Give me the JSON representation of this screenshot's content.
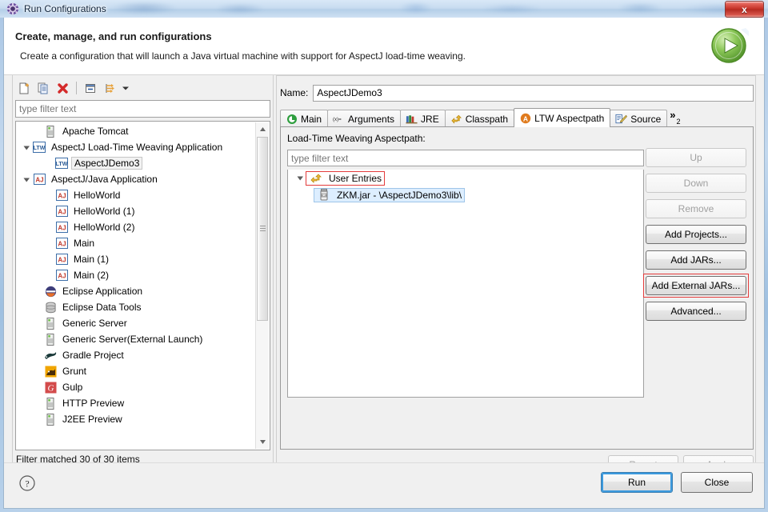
{
  "window": {
    "title": "Run Configurations",
    "title_icon": "gear-icon",
    "close_label": "x"
  },
  "header": {
    "title": "Create, manage, and run configurations",
    "description": "Create a configuration that will launch a Java virtual machine with support for AspectJ load-time weaving.",
    "badge_icon": "run-green-play-icon"
  },
  "left_panel": {
    "toolbar": [
      {
        "name": "new-launch-configuration-icon",
        "icon": "new-document-icon"
      },
      {
        "name": "duplicate-icon",
        "icon": "copy-icon"
      },
      {
        "name": "delete-icon",
        "icon": "red-x-icon"
      },
      {
        "name": "collapse-all-icon",
        "icon": "collapse-all-icon"
      },
      {
        "name": "filter-icon",
        "icon": "filter-arrows-icon"
      },
      {
        "name": "view-menu-icon",
        "icon": "chevron-down-icon"
      }
    ],
    "filter_placeholder": "type filter text",
    "filter_value": "",
    "status": "Filter matched 30 of 30 items",
    "tree": [
      {
        "label": "Apache Tomcat",
        "icon": "server-icon",
        "indent": 2,
        "expander": "none",
        "selected": false
      },
      {
        "label": "AspectJ Load-Time Weaving Application",
        "icon": "ltw-icon",
        "indent": 1,
        "expander": "expanded",
        "selected": false
      },
      {
        "label": "AspectJDemo3",
        "icon": "ltw-icon",
        "indent": 3,
        "expander": "none",
        "selected": true
      },
      {
        "label": "AspectJ/Java Application",
        "icon": "aj-icon",
        "indent": 1,
        "expander": "expanded",
        "selected": false
      },
      {
        "label": "HelloWorld",
        "icon": "aj-icon",
        "indent": 3,
        "expander": "none",
        "selected": false
      },
      {
        "label": "HelloWorld (1)",
        "icon": "aj-icon",
        "indent": 3,
        "expander": "none",
        "selected": false
      },
      {
        "label": "HelloWorld (2)",
        "icon": "aj-icon",
        "indent": 3,
        "expander": "none",
        "selected": false
      },
      {
        "label": "Main",
        "icon": "aj-icon",
        "indent": 3,
        "expander": "none",
        "selected": false
      },
      {
        "label": "Main (1)",
        "icon": "aj-icon",
        "indent": 3,
        "expander": "none",
        "selected": false
      },
      {
        "label": "Main (2)",
        "icon": "aj-icon",
        "indent": 3,
        "expander": "none",
        "selected": false
      },
      {
        "label": "Eclipse Application",
        "icon": "eclipse-icon",
        "indent": 2,
        "expander": "none",
        "selected": false
      },
      {
        "label": "Eclipse Data Tools",
        "icon": "database-icon",
        "indent": 2,
        "expander": "none",
        "selected": false
      },
      {
        "label": "Generic Server",
        "icon": "server-icon",
        "indent": 2,
        "expander": "none",
        "selected": false
      },
      {
        "label": "Generic Server(External Launch)",
        "icon": "server-icon",
        "indent": 2,
        "expander": "none",
        "selected": false
      },
      {
        "label": "Gradle Project",
        "icon": "gradle-icon",
        "indent": 2,
        "expander": "none",
        "selected": false
      },
      {
        "label": "Grunt",
        "icon": "grunt-icon",
        "indent": 2,
        "expander": "none",
        "selected": false
      },
      {
        "label": "Gulp",
        "icon": "gulp-icon",
        "indent": 2,
        "expander": "none",
        "selected": false
      },
      {
        "label": "HTTP Preview",
        "icon": "server-icon",
        "indent": 2,
        "expander": "none",
        "selected": false
      },
      {
        "label": "J2EE Preview",
        "icon": "server-icon",
        "indent": 2,
        "expander": "none",
        "selected": false
      }
    ]
  },
  "right_panel": {
    "name_label": "Name:",
    "name_value": "AspectJDemo3",
    "tabs": [
      {
        "label": "Main",
        "icon": "main-green-icon",
        "active": false
      },
      {
        "label": "Arguments",
        "icon": "arguments-xeq-icon",
        "active": false
      },
      {
        "label": "JRE",
        "icon": "jre-books-icon",
        "active": false
      },
      {
        "label": "Classpath",
        "icon": "classpath-arrows-icon",
        "active": false
      },
      {
        "label": "LTW Aspectpath",
        "icon": "aspectpath-orange-icon",
        "active": true
      },
      {
        "label": "Source",
        "icon": "source-pencil-icon",
        "active": false
      }
    ],
    "tab_overflow": {
      "chevron": "»",
      "count": "2"
    },
    "section_label": "Load-Time Weaving Aspectpath:",
    "entries_filter_placeholder": "type filter text",
    "entries_filter_value": "",
    "entries": [
      {
        "label": "User Entries",
        "icon": "user-entries-icon",
        "indent": 1,
        "expander": "expanded",
        "highlight": "red"
      },
      {
        "label": "ZKM.jar - \\AspectJDemo3\\lib\\",
        "icon": "jar-icon",
        "indent": 2,
        "expander": "none",
        "highlight": "selected"
      }
    ],
    "side_buttons": [
      {
        "label": "Up",
        "enabled": false,
        "highlight": false
      },
      {
        "label": "Down",
        "enabled": false,
        "highlight": false
      },
      {
        "label": "Remove",
        "enabled": false,
        "highlight": false
      },
      {
        "label": "Add Projects...",
        "enabled": true,
        "highlight": false
      },
      {
        "label": "Add JARs...",
        "enabled": true,
        "highlight": false
      },
      {
        "label": "Add External JARs...",
        "enabled": true,
        "highlight": true
      },
      {
        "label": "Advanced...",
        "enabled": true,
        "highlight": false
      }
    ],
    "revert_label": "Revert",
    "apply_label": "Apply"
  },
  "footer": {
    "help_icon": "question-mark-icon",
    "run_label": "Run",
    "close_label": "Close"
  },
  "colors": {
    "accent_blue": "#3c9ade",
    "highlight_red": "#e33b3b",
    "selection_blue": "#ddeeff",
    "title_bar": "#c8dcf0",
    "panel_bg": "#f0f0f0"
  }
}
